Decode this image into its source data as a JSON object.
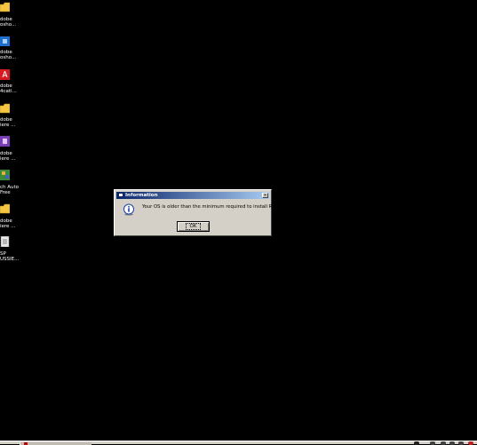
{
  "desktop": {
    "icons": [
      {
        "line1": "dobe",
        "line2": "osho...",
        "icon": "folder-icon",
        "color": "#f5c542"
      },
      {
        "line1": "dobe",
        "line2": "osho...",
        "icon": "photoshop-icon",
        "color": "#1f6fd1"
      },
      {
        "line1": "dobe",
        "line2": "4cati...",
        "icon": "acrobat-icon",
        "color": "#d71920"
      },
      {
        "line1": "dobe",
        "line2": "iere ...",
        "icon": "folder-icon",
        "color": "#f5c542"
      },
      {
        "line1": "dobe",
        "line2": "iere ...",
        "icon": "premiere-icon",
        "color": "#7b3fb5"
      },
      {
        "line1": "ch Auto",
        "line2": "Free",
        "icon": "app-icon",
        "color": "#3a8a3a"
      },
      {
        "line1": "dobe",
        "line2": "iere ...",
        "icon": "folder-icon",
        "color": "#f5c542"
      },
      {
        "line1": "SP",
        "line2": "USSIE...",
        "icon": "document-icon",
        "color": "#e8e8e8"
      }
    ]
  },
  "dialog": {
    "title": "Information",
    "close_label": "×",
    "message": "Your OS is older than the minimum required to install Reality",
    "ok_label": "OK",
    "icon": "info-icon"
  },
  "colors": {
    "desktop_bg": "#000000",
    "dialog_bg": "#d4d0c8",
    "titlebar_start": "#0a246a",
    "titlebar_end": "#a6caf0"
  }
}
